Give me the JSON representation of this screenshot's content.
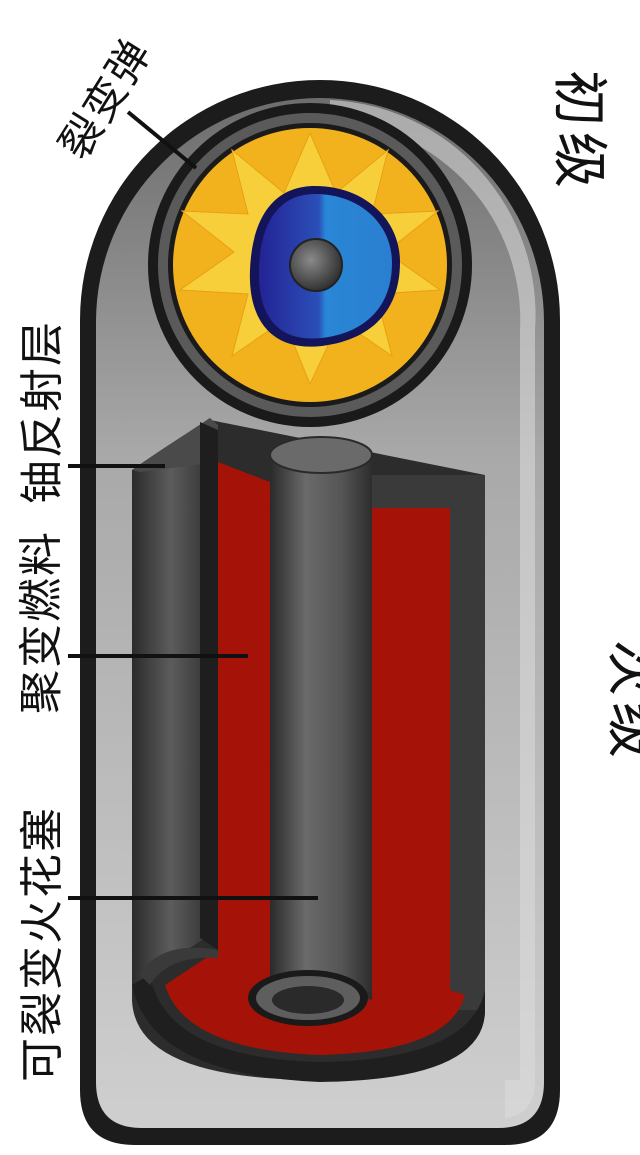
{
  "labels": {
    "fission_bomb": "裂变弹",
    "primary": "初级",
    "secondary": "次级",
    "uranium_reflector": "铀反射层",
    "fusion_fuel": "聚变燃料",
    "fissile_spark_plug": "可裂变火花塞"
  },
  "colors": {
    "casing_outer": "#1a1a1a",
    "casing_light": "#c9c9c9",
    "casing_dark": "#777777",
    "tamper_dark": "#2e2e2e",
    "fusion_fuel": "#a51208",
    "primary_explosive": "#f2b21e",
    "primary_explosive_star": "#f7cf3a",
    "pit_blue_dark": "#2a2a9c",
    "pit_blue_light": "#2a7fd0",
    "core_grey": "#555555"
  }
}
